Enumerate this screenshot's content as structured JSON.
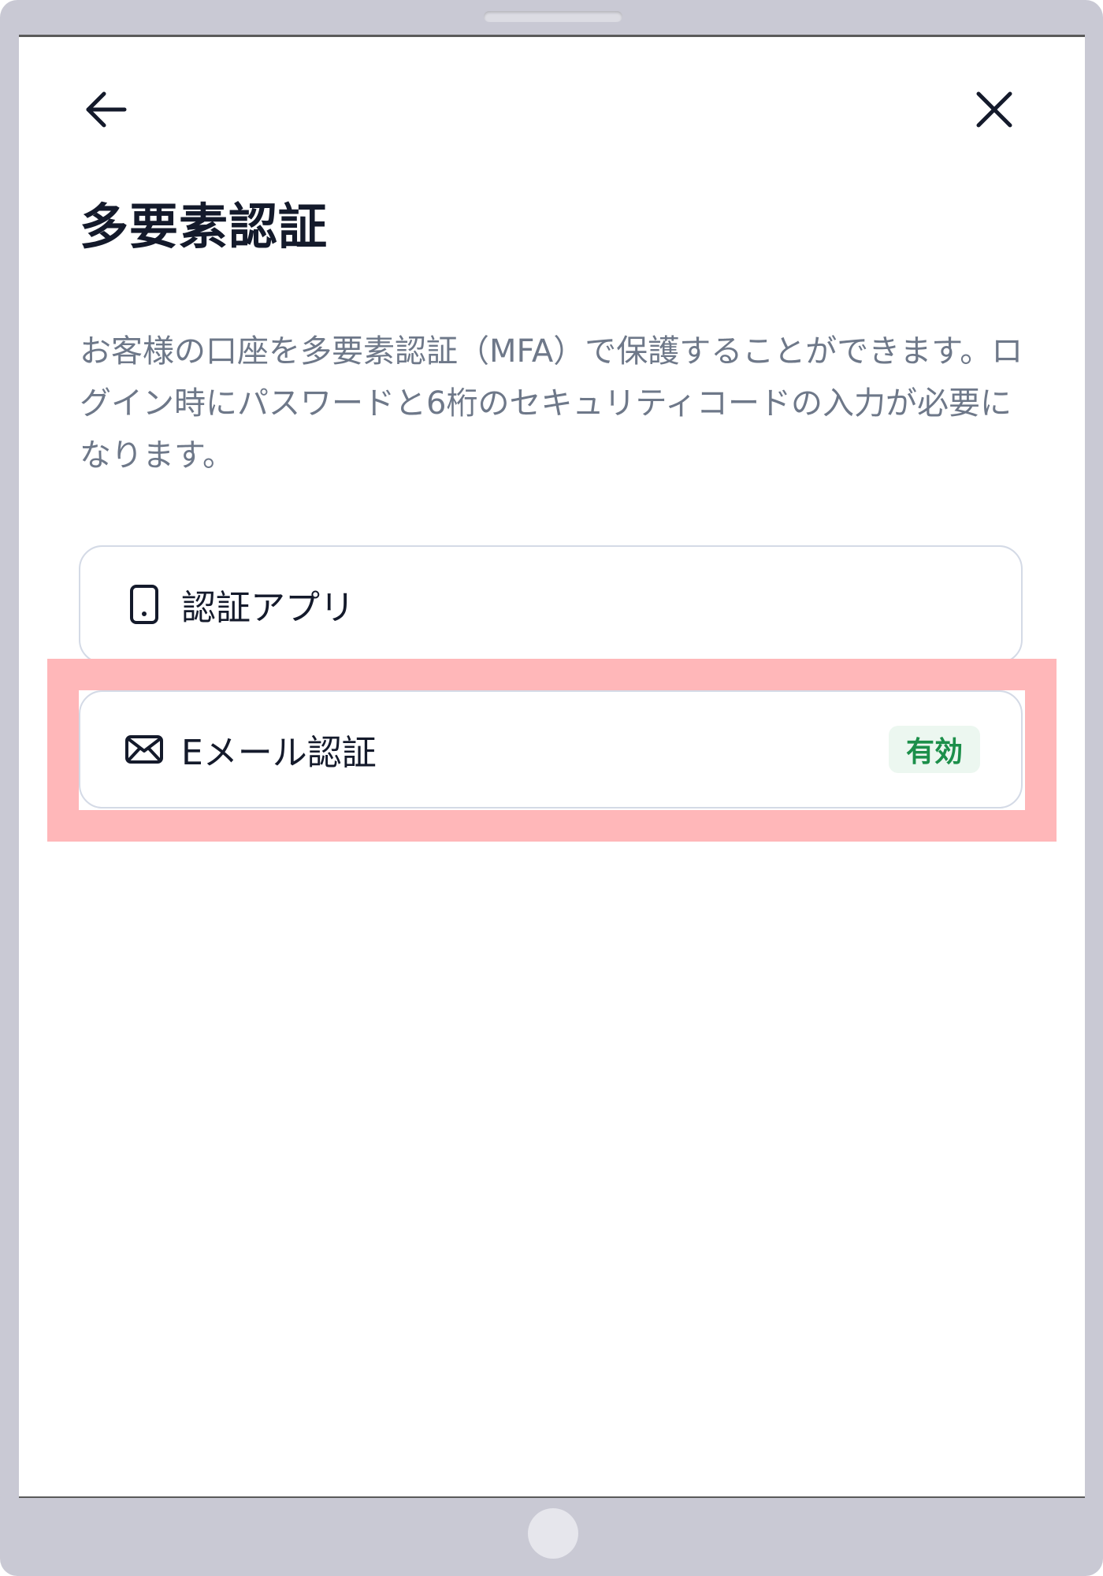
{
  "header": {
    "back_icon": "arrow-left-icon",
    "close_icon": "close-icon"
  },
  "page": {
    "title": "多要素認証",
    "description": "お客様の口座を多要素認証（MFA）で保護することができます。ログイン時にパスワードと6桁のセキュリティコードの入力が必要になります。"
  },
  "options": [
    {
      "label": "認証アプリ",
      "icon": "smartphone-icon"
    },
    {
      "label": "Eメール認証",
      "icon": "mail-icon",
      "status": "有効"
    }
  ],
  "colors": {
    "title": "#141a2b",
    "description": "#6e7889",
    "card_border": "#d4dae6",
    "badge_bg": "#ecf7f0",
    "badge_text": "#1c8f4a",
    "highlight": "#ffb7b9",
    "device_frame": "#c9c9d4"
  }
}
